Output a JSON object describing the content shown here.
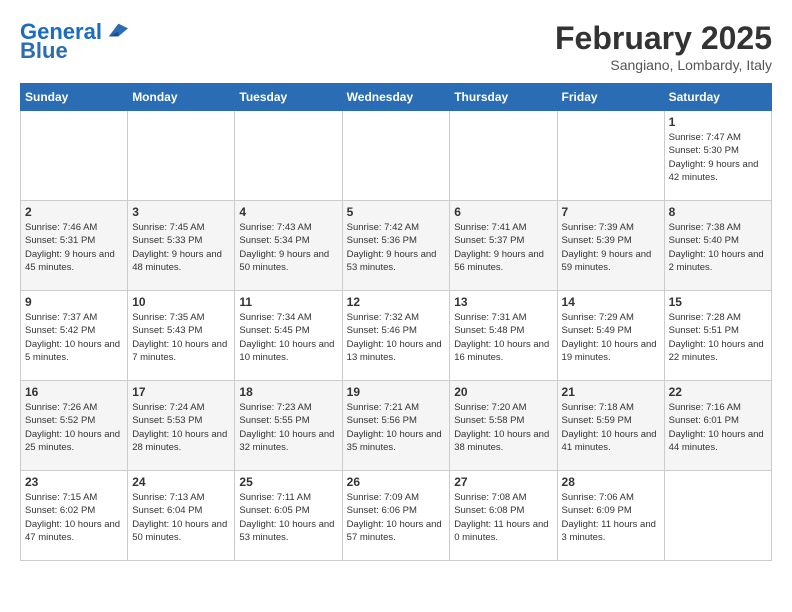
{
  "logo": {
    "line1": "General",
    "line2": "Blue"
  },
  "title": "February 2025",
  "location": "Sangiano, Lombardy, Italy",
  "weekdays": [
    "Sunday",
    "Monday",
    "Tuesday",
    "Wednesday",
    "Thursday",
    "Friday",
    "Saturday"
  ],
  "weeks": [
    [
      {
        "day": "",
        "info": ""
      },
      {
        "day": "",
        "info": ""
      },
      {
        "day": "",
        "info": ""
      },
      {
        "day": "",
        "info": ""
      },
      {
        "day": "",
        "info": ""
      },
      {
        "day": "",
        "info": ""
      },
      {
        "day": "1",
        "info": "Sunrise: 7:47 AM\nSunset: 5:30 PM\nDaylight: 9 hours and 42 minutes."
      }
    ],
    [
      {
        "day": "2",
        "info": "Sunrise: 7:46 AM\nSunset: 5:31 PM\nDaylight: 9 hours and 45 minutes."
      },
      {
        "day": "3",
        "info": "Sunrise: 7:45 AM\nSunset: 5:33 PM\nDaylight: 9 hours and 48 minutes."
      },
      {
        "day": "4",
        "info": "Sunrise: 7:43 AM\nSunset: 5:34 PM\nDaylight: 9 hours and 50 minutes."
      },
      {
        "day": "5",
        "info": "Sunrise: 7:42 AM\nSunset: 5:36 PM\nDaylight: 9 hours and 53 minutes."
      },
      {
        "day": "6",
        "info": "Sunrise: 7:41 AM\nSunset: 5:37 PM\nDaylight: 9 hours and 56 minutes."
      },
      {
        "day": "7",
        "info": "Sunrise: 7:39 AM\nSunset: 5:39 PM\nDaylight: 9 hours and 59 minutes."
      },
      {
        "day": "8",
        "info": "Sunrise: 7:38 AM\nSunset: 5:40 PM\nDaylight: 10 hours and 2 minutes."
      }
    ],
    [
      {
        "day": "9",
        "info": "Sunrise: 7:37 AM\nSunset: 5:42 PM\nDaylight: 10 hours and 5 minutes."
      },
      {
        "day": "10",
        "info": "Sunrise: 7:35 AM\nSunset: 5:43 PM\nDaylight: 10 hours and 7 minutes."
      },
      {
        "day": "11",
        "info": "Sunrise: 7:34 AM\nSunset: 5:45 PM\nDaylight: 10 hours and 10 minutes."
      },
      {
        "day": "12",
        "info": "Sunrise: 7:32 AM\nSunset: 5:46 PM\nDaylight: 10 hours and 13 minutes."
      },
      {
        "day": "13",
        "info": "Sunrise: 7:31 AM\nSunset: 5:48 PM\nDaylight: 10 hours and 16 minutes."
      },
      {
        "day": "14",
        "info": "Sunrise: 7:29 AM\nSunset: 5:49 PM\nDaylight: 10 hours and 19 minutes."
      },
      {
        "day": "15",
        "info": "Sunrise: 7:28 AM\nSunset: 5:51 PM\nDaylight: 10 hours and 22 minutes."
      }
    ],
    [
      {
        "day": "16",
        "info": "Sunrise: 7:26 AM\nSunset: 5:52 PM\nDaylight: 10 hours and 25 minutes."
      },
      {
        "day": "17",
        "info": "Sunrise: 7:24 AM\nSunset: 5:53 PM\nDaylight: 10 hours and 28 minutes."
      },
      {
        "day": "18",
        "info": "Sunrise: 7:23 AM\nSunset: 5:55 PM\nDaylight: 10 hours and 32 minutes."
      },
      {
        "day": "19",
        "info": "Sunrise: 7:21 AM\nSunset: 5:56 PM\nDaylight: 10 hours and 35 minutes."
      },
      {
        "day": "20",
        "info": "Sunrise: 7:20 AM\nSunset: 5:58 PM\nDaylight: 10 hours and 38 minutes."
      },
      {
        "day": "21",
        "info": "Sunrise: 7:18 AM\nSunset: 5:59 PM\nDaylight: 10 hours and 41 minutes."
      },
      {
        "day": "22",
        "info": "Sunrise: 7:16 AM\nSunset: 6:01 PM\nDaylight: 10 hours and 44 minutes."
      }
    ],
    [
      {
        "day": "23",
        "info": "Sunrise: 7:15 AM\nSunset: 6:02 PM\nDaylight: 10 hours and 47 minutes."
      },
      {
        "day": "24",
        "info": "Sunrise: 7:13 AM\nSunset: 6:04 PM\nDaylight: 10 hours and 50 minutes."
      },
      {
        "day": "25",
        "info": "Sunrise: 7:11 AM\nSunset: 6:05 PM\nDaylight: 10 hours and 53 minutes."
      },
      {
        "day": "26",
        "info": "Sunrise: 7:09 AM\nSunset: 6:06 PM\nDaylight: 10 hours and 57 minutes."
      },
      {
        "day": "27",
        "info": "Sunrise: 7:08 AM\nSunset: 6:08 PM\nDaylight: 11 hours and 0 minutes."
      },
      {
        "day": "28",
        "info": "Sunrise: 7:06 AM\nSunset: 6:09 PM\nDaylight: 11 hours and 3 minutes."
      },
      {
        "day": "",
        "info": ""
      }
    ]
  ]
}
